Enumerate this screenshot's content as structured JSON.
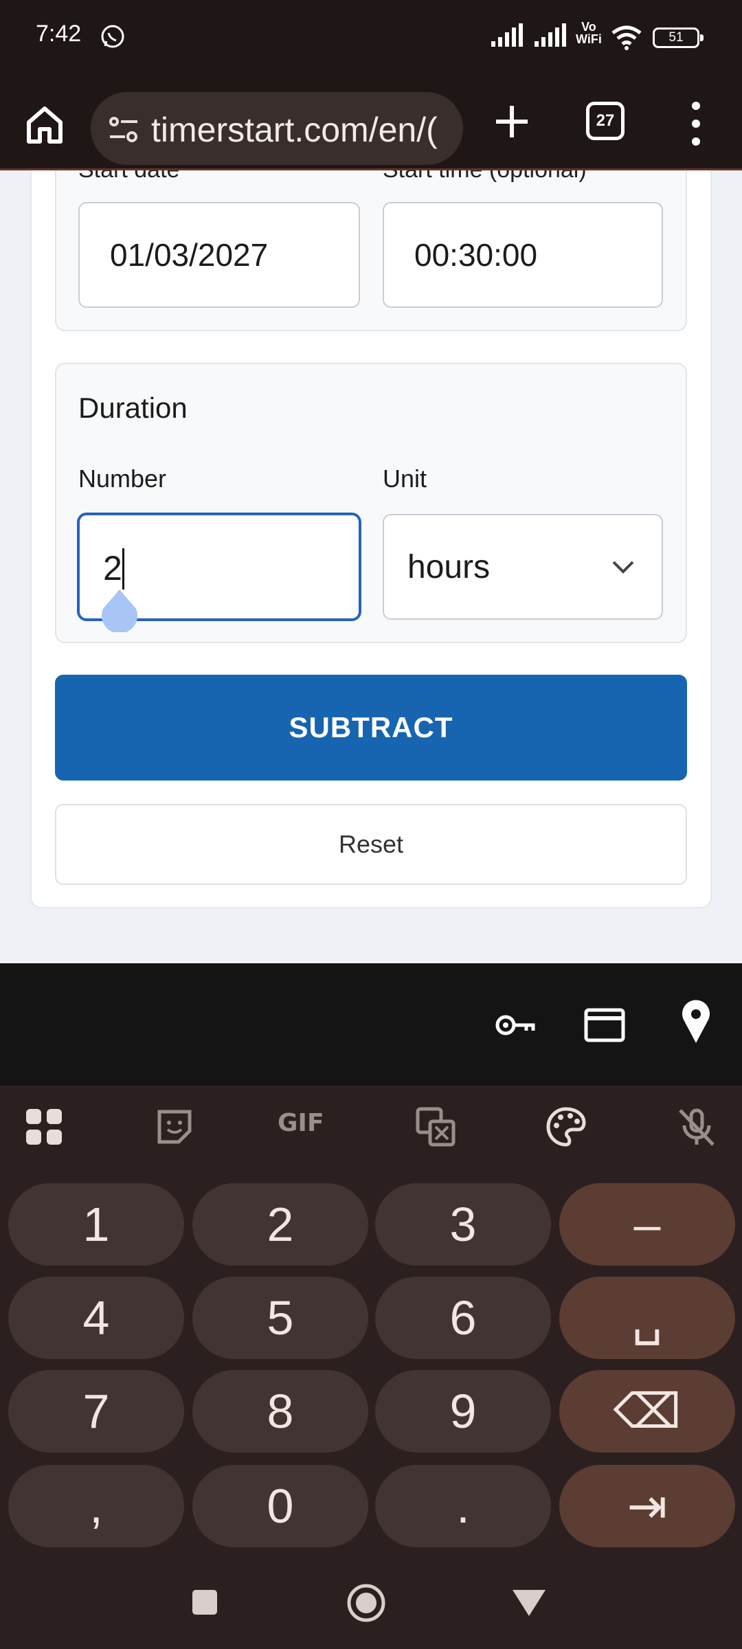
{
  "status_bar": {
    "time": "7:42",
    "battery": "51",
    "vowifi_top": "Vo",
    "vowifi_bottom": "WiFi"
  },
  "browser": {
    "url": "timerstart.com/en/(",
    "tab_count": "27"
  },
  "form": {
    "start_date_label": "Start date",
    "start_time_label": "Start time (optional)",
    "start_date_value": "01/03/2027",
    "start_time_value": "00:30:00",
    "duration_title": "Duration",
    "number_label": "Number",
    "number_value": "2",
    "unit_label": "Unit",
    "unit_value": "hours",
    "subtract_label": "SUBTRACT",
    "reset_label": "Reset"
  },
  "keyboard": {
    "toolbar": [
      "apps-grid-icon",
      "sticker-icon",
      "GIF",
      "translate-icon",
      "palette-icon",
      "mic-off-icon"
    ],
    "rows": [
      [
        "1",
        "2",
        "3",
        "–"
      ],
      [
        "4",
        "5",
        "6",
        "␣"
      ],
      [
        "7",
        "8",
        "9",
        "⌫"
      ],
      [
        ",",
        "0",
        ".",
        "⇥"
      ]
    ]
  },
  "colors": {
    "primary_button": "#1765b1",
    "focus_border": "#2762c2",
    "system_bar": "#1f1616",
    "keyboard_bg": "#2b201f",
    "key_bg": "#413432",
    "key_accent": "#5c3d33"
  }
}
